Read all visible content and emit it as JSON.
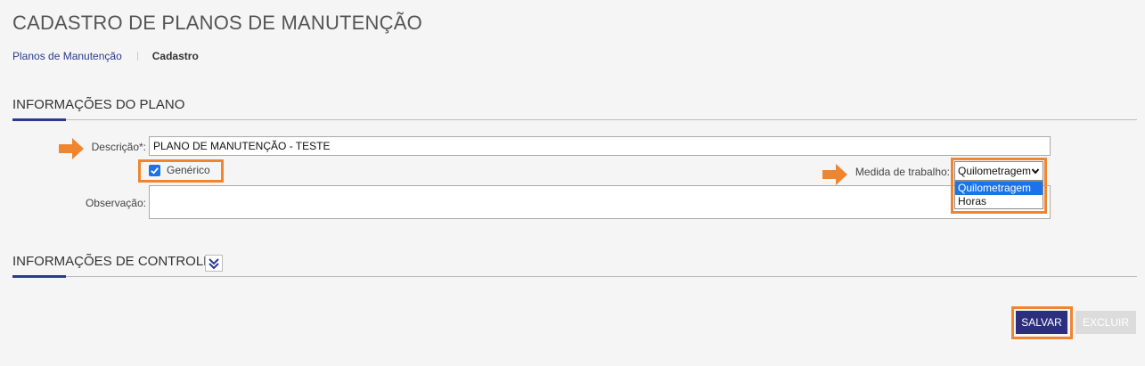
{
  "page": {
    "title": "CADASTRO DE PLANOS DE MANUTENÇÃO"
  },
  "breadcrumb": {
    "link": "Planos de Manutenção",
    "current": "Cadastro"
  },
  "section_plano": {
    "title": "INFORMAÇÕES DO PLANO"
  },
  "form": {
    "descricao_label": "Descrição*:",
    "descricao_value": "PLANO DE MANUTENÇÃO - TESTE",
    "generico_label": "Genérico",
    "generico_checked": true,
    "medida_label": "Medida de trabalho:",
    "medida_selected": "Quilometragem",
    "medida_options": [
      "Quilometragem",
      "Horas"
    ],
    "observacao_label": "Observação:",
    "observacao_value": ""
  },
  "section_controle": {
    "title": "INFORMAÇÕES DE CONTROLE"
  },
  "actions": {
    "save_label": "SALVAR",
    "delete_label": "EXCLUIR"
  },
  "colors": {
    "accent": "#2b3a8f",
    "highlight": "#f08530",
    "selected_option": "#1a73e8"
  },
  "icons": {
    "annotation_arrow": "arrow-right-icon",
    "checkbox": "check-icon",
    "select": "chevron-down-icon",
    "expand": "double-chevron-down-icon"
  }
}
